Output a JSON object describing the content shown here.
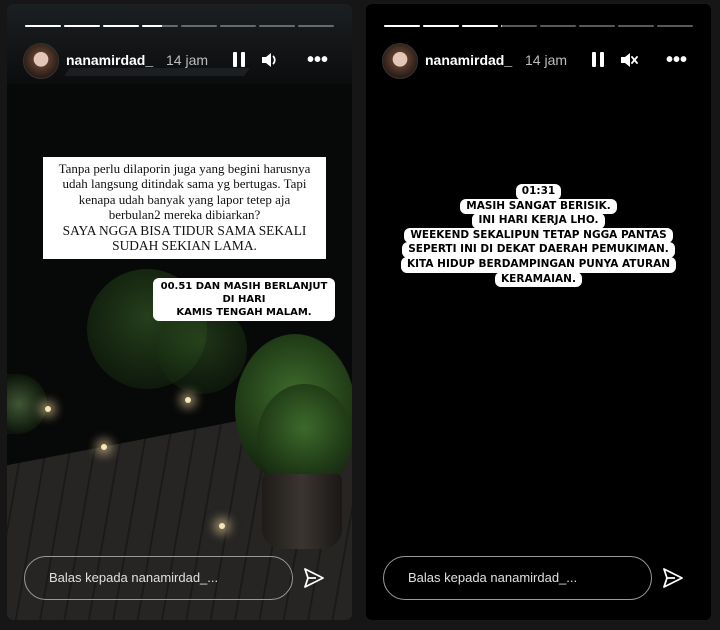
{
  "stories": [
    {
      "id": "left",
      "progress": [
        1,
        1,
        1,
        0.55,
        0,
        0,
        0,
        0
      ],
      "header": {
        "username": "nanamirdad_",
        "time": "14 jam",
        "sound": "on"
      },
      "text_box": {
        "lines": [
          "Tanpa perlu dilaporin juga yang begini harusnya",
          "udah langsung ditindak sama yg bertugas. Tapi",
          "kenapa udah banyak yang lapor tetep aja",
          "berbulan2 mereka dibiarkan?",
          "SAYA NGGA BISA TIDUR SAMA SEKALI",
          "SUDAH SEKIAN LAMA."
        ]
      },
      "stamp": {
        "line1": "00.51 DAN MASIH BERLANJUT DI HARI",
        "line2": "KAMIS TENGAH MALAM."
      },
      "reply_placeholder": "Balas kepada nanamirdad_..."
    },
    {
      "id": "right",
      "progress": [
        1,
        1,
        1,
        0.03,
        0,
        0,
        0,
        0
      ],
      "header": {
        "username": "nanamirdad_",
        "time": "14 jam",
        "sound": "muted"
      },
      "text_lines": [
        "01:31",
        "MASIH SANGAT BERISIK.",
        "INI HARI KERJA LHO.",
        "WEEKEND SEKALIPUN TETAP NGGA PANTAS",
        "SEPERTI INI DI DEKAT DAERAH PEMUKIMAN.",
        "KITA HIDUP BERDAMPINGAN PUNYA ATURAN",
        "KERAMAIAN."
      ],
      "reply_placeholder": "Balas kepada nanamirdad_..."
    }
  ],
  "icons": {
    "pause": "pause-icon",
    "volume": "volume-icon",
    "mute": "mute-icon",
    "more": "more-icon",
    "send": "send-icon"
  },
  "colors": {
    "background": "#161616",
    "text": "#ffffff",
    "muted_text": "#bdbdbd"
  }
}
